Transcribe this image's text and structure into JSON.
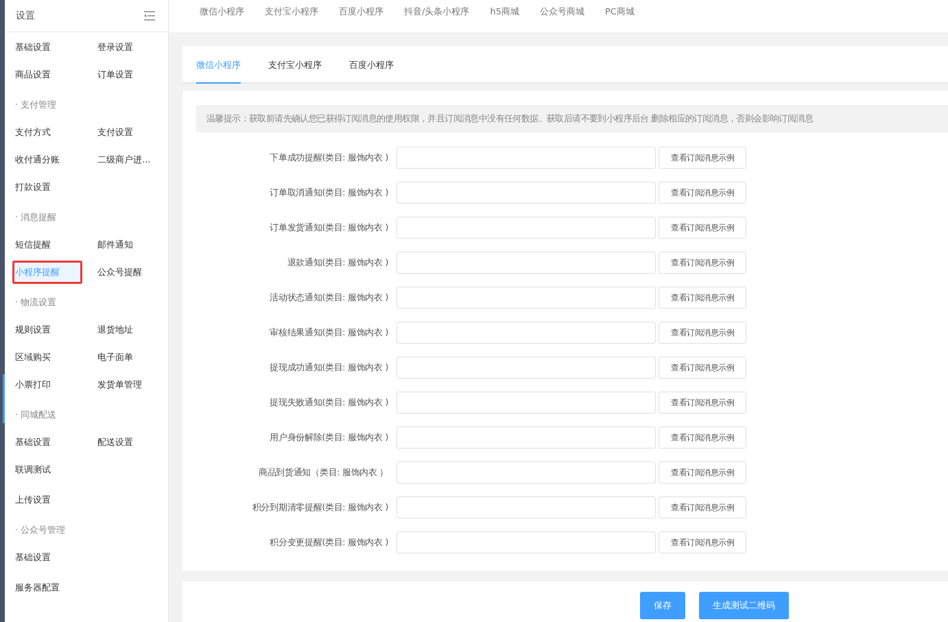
{
  "sidebar": {
    "title": "设置",
    "sections": [
      {
        "items": [
          {
            "label": "基础设置",
            "selected": false
          },
          {
            "label": "登录设置",
            "selected": false
          },
          {
            "label": "商品设置",
            "selected": false
          },
          {
            "label": "订单设置",
            "selected": false
          }
        ]
      },
      {
        "title": "· 支付管理",
        "items": [
          {
            "label": "支付方式",
            "selected": false
          },
          {
            "label": "支付设置",
            "selected": false
          },
          {
            "label": "收付通分账",
            "selected": false
          },
          {
            "label": "二级商户进...",
            "selected": false
          },
          {
            "label": "打款设置",
            "selected": false
          }
        ]
      },
      {
        "title": "· 消息提醒",
        "items": [
          {
            "label": "短信提醒",
            "selected": false
          },
          {
            "label": "邮件通知",
            "selected": false
          },
          {
            "label": "小程序提醒",
            "selected": true
          },
          {
            "label": "公众号提醒",
            "selected": false
          }
        ]
      },
      {
        "title": "· 物流设置",
        "items": [
          {
            "label": "规则设置",
            "selected": false
          },
          {
            "label": "退货地址",
            "selected": false
          },
          {
            "label": "区域购买",
            "selected": false
          },
          {
            "label": "电子面单",
            "selected": false
          },
          {
            "label": "小票打印",
            "selected": false
          },
          {
            "label": "发货单管理",
            "selected": false
          }
        ]
      },
      {
        "title": "· 同城配送",
        "items": [
          {
            "label": "基础设置",
            "selected": false
          },
          {
            "label": "配送设置",
            "selected": false
          },
          {
            "label": "联调测试",
            "selected": false
          }
        ]
      },
      {
        "items": [
          {
            "label": "上传设置",
            "selected": false
          }
        ]
      },
      {
        "title": "· 公众号管理",
        "items": [
          {
            "label": "基础设置",
            "selected": false
          }
        ]
      },
      {
        "items": [
          {
            "label": "服务器配置",
            "selected": false
          }
        ]
      }
    ]
  },
  "top_tabs": [
    "微信小程序",
    "支付宝小程序",
    "百度小程序",
    "抖音/头条小程序",
    "h5商城",
    "公众号商城",
    "PC商城"
  ],
  "tabs": [
    {
      "label": "微信小程序",
      "selected": true
    },
    {
      "label": "支付宝小程序",
      "selected": false
    },
    {
      "label": "百度小程序",
      "selected": false
    }
  ],
  "notice": "温馨提示：获取前请先确认您已获得订阅消息的使用权限，并且订阅消息中没有任何数据。获取后请不要到小程序后台 删除相应的订阅消息，否则会影响订阅消息",
  "rows": [
    {
      "label": "下单成功提醒(类目: 服饰内衣 )",
      "button": "查看订阅消息示例"
    },
    {
      "label": "订单取消通知(类目: 服饰内衣 )",
      "button": "查看订阅消息示例"
    },
    {
      "label": "订单发货通知(类目: 服饰内衣 )",
      "button": "查看订阅消息示例"
    },
    {
      "label": "退款通知(类目: 服饰内衣 )",
      "button": "查看订阅消息示例"
    },
    {
      "label": "活动状态通知(类目: 服饰内衣 )",
      "button": "查看订阅消息示例"
    },
    {
      "label": "审核结果通知(类目: 服饰内衣 )",
      "button": "查看订阅消息示例"
    },
    {
      "label": "提现成功通知(类目: 服饰内衣 )",
      "button": "查看订阅消息示例"
    },
    {
      "label": "提现失败通知(类目: 服饰内衣 )",
      "button": "查看订阅消息示例"
    },
    {
      "label": "用户身份解除(类目: 服饰内衣 )",
      "button": "查看订阅消息示例"
    },
    {
      "label": "商品到货通知（类目: 服饰内衣 ）",
      "button": "查看订阅消息示例"
    },
    {
      "label": "积分到期清零提醒(类目: 服饰内衣 )",
      "button": "查看订阅消息示例"
    },
    {
      "label": "积分变更提醒(类目: 服饰内衣 )",
      "button": "查看订阅消息示例"
    }
  ],
  "footer_buttons": [
    "保存",
    "生成测试二维码"
  ]
}
